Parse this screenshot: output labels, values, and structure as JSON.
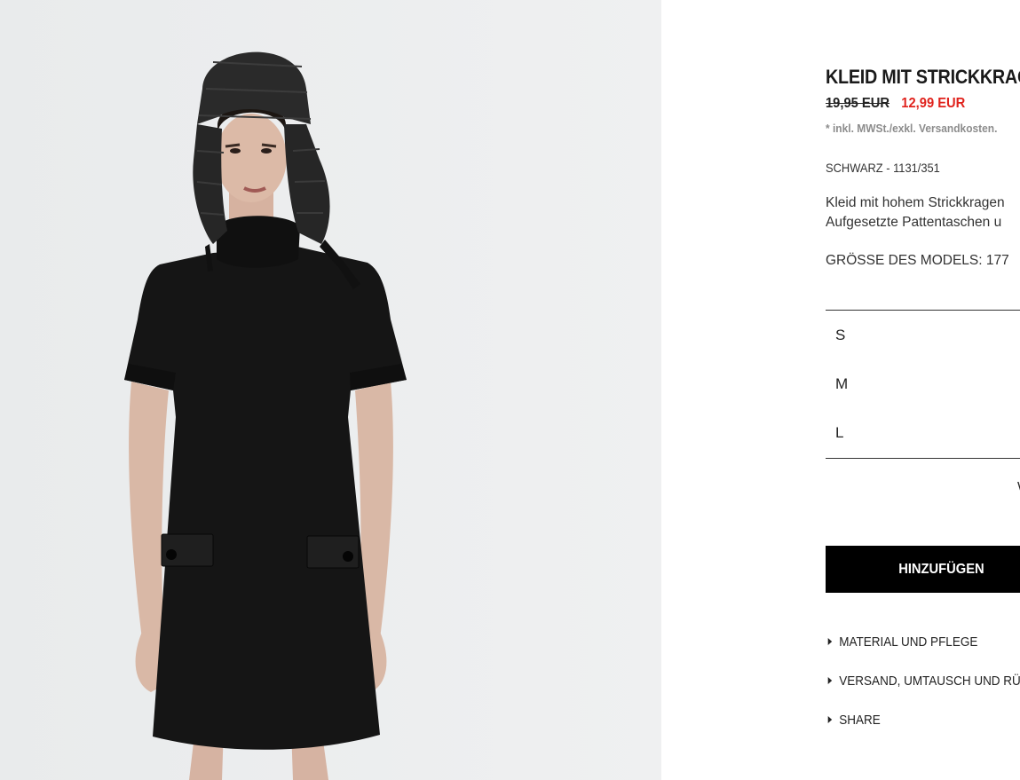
{
  "product": {
    "title": "KLEID MIT STRICKKRAGEN",
    "old_price": "19,95 EUR",
    "new_price": "12,99 EUR",
    "tax_note": "* inkl. MWSt./exkl. Versandkosten.",
    "color_ref": "SCHWARZ - 1131/351",
    "description_line1": "Kleid mit hohem Strickkragen",
    "description_line2": "Aufgesetzte Pattentaschen u",
    "model_size": "GRÖSSE DES MODELS: 177"
  },
  "sizes": [
    "S",
    "M",
    "L"
  ],
  "size_guide_label": "W",
  "add_button_label": "HINZUFÜGEN",
  "accordion": [
    "MATERIAL UND PFLEGE",
    "VERSAND, UMTAUSCH UND RÜCKGABE",
    "SHARE"
  ],
  "colors": {
    "sale_red": "#e0221c",
    "button_bg": "#000000"
  }
}
